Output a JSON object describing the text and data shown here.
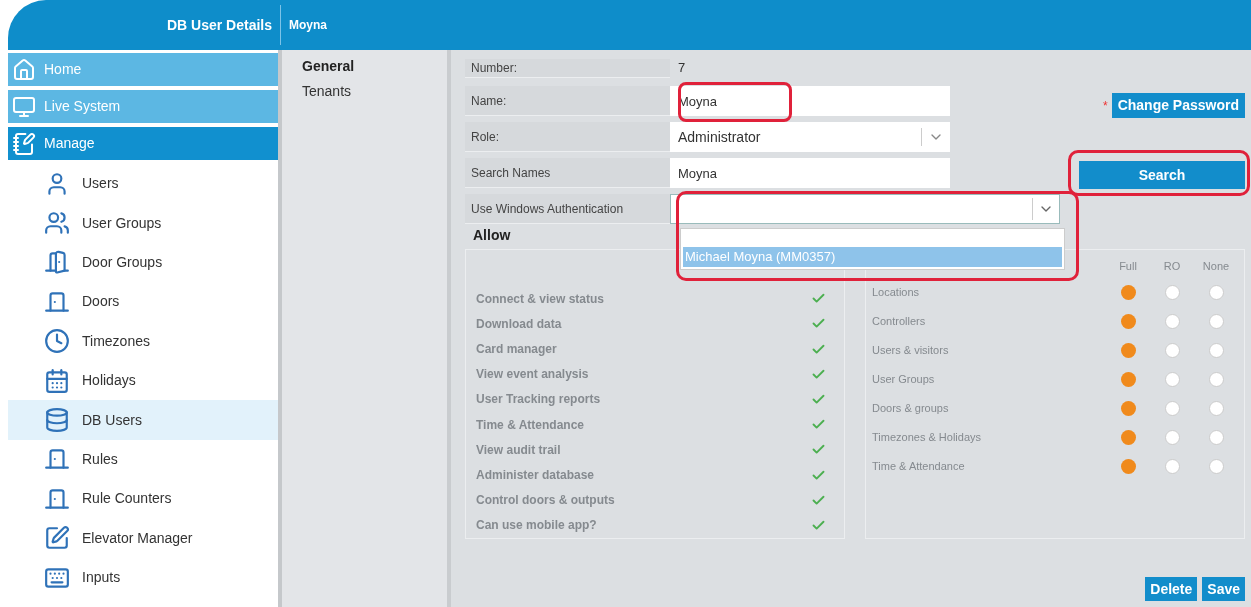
{
  "header": {
    "title": "DB User Details",
    "subtitle": "Moyna"
  },
  "sidebar": {
    "sections": [
      {
        "label": "Home",
        "selected": false
      },
      {
        "label": "Live System",
        "selected": false
      },
      {
        "label": "Manage",
        "selected": true,
        "children": [
          {
            "label": "Users",
            "selected": false
          },
          {
            "label": "User Groups",
            "selected": false
          },
          {
            "label": "Door Groups",
            "selected": false
          },
          {
            "label": "Doors",
            "selected": false
          },
          {
            "label": "Timezones",
            "selected": false
          },
          {
            "label": "Holidays",
            "selected": false
          },
          {
            "label": "DB Users",
            "selected": true
          },
          {
            "label": "Rules",
            "selected": false
          },
          {
            "label": "Rule Counters",
            "selected": false
          },
          {
            "label": "Elevator Manager",
            "selected": false
          },
          {
            "label": "Inputs",
            "selected": false
          }
        ]
      }
    ]
  },
  "tabs": [
    {
      "label": "General",
      "selected": true
    },
    {
      "label": "Tenants",
      "selected": false
    }
  ],
  "form": {
    "fields": [
      {
        "kind": "static",
        "label": "Number:",
        "value": "7"
      },
      {
        "kind": "text",
        "label": "Name:",
        "value": "Moyna"
      },
      {
        "kind": "select",
        "label": "Role:",
        "value": "Administrator"
      },
      {
        "kind": "text",
        "label": "Search Names",
        "value": "Moyna"
      },
      {
        "kind": "combo",
        "label": "Use Windows Authentication",
        "expanded": true,
        "options": [
          {
            "label": "Michael Moyna (MM0357)",
            "selected": true
          }
        ]
      }
    ]
  },
  "change_password": {
    "label": "Change Password",
    "required_mark": "*"
  },
  "search_button": {
    "label": "Search"
  },
  "allow": {
    "title": "Allow",
    "disabled": true,
    "permissions": [
      {
        "label": "Connect & view status",
        "checked": true
      },
      {
        "label": "Download data",
        "checked": true
      },
      {
        "label": "Card manager",
        "checked": true
      },
      {
        "label": "View event analysis",
        "checked": true
      },
      {
        "label": "User Tracking reports",
        "checked": true
      },
      {
        "label": "Time & Attendance",
        "checked": true
      },
      {
        "label": "View audit trail",
        "checked": true
      },
      {
        "label": "Administer database",
        "checked": true
      },
      {
        "label": "Control doors & outputs",
        "checked": true
      },
      {
        "label": "Can use mobile app?",
        "checked": true
      }
    ],
    "access": {
      "columns": [
        "Full",
        "RO",
        "None"
      ],
      "rows": [
        {
          "label": "Locations",
          "choices": [
            {
              "selected": true
            },
            {
              "selected": false
            },
            {
              "selected": false
            }
          ]
        },
        {
          "label": "Controllers",
          "choices": [
            {
              "selected": true
            },
            {
              "selected": false
            },
            {
              "selected": false
            }
          ]
        },
        {
          "label": "Users & visitors",
          "choices": [
            {
              "selected": true
            },
            {
              "selected": false
            },
            {
              "selected": false
            }
          ]
        },
        {
          "label": "User Groups",
          "choices": [
            {
              "selected": true
            },
            {
              "selected": false
            },
            {
              "selected": false
            }
          ]
        },
        {
          "label": "Doors & groups",
          "choices": [
            {
              "selected": true
            },
            {
              "selected": false
            },
            {
              "selected": false
            }
          ]
        },
        {
          "label": "Timezones & Holidays",
          "choices": [
            {
              "selected": true
            },
            {
              "selected": false
            },
            {
              "selected": false
            }
          ]
        },
        {
          "label": "Time & Attendance",
          "choices": [
            {
              "selected": true
            },
            {
              "selected": false
            },
            {
              "selected": false
            }
          ]
        }
      ]
    }
  },
  "footer_buttons": [
    {
      "label": "Delete"
    },
    {
      "label": "Save"
    }
  ]
}
